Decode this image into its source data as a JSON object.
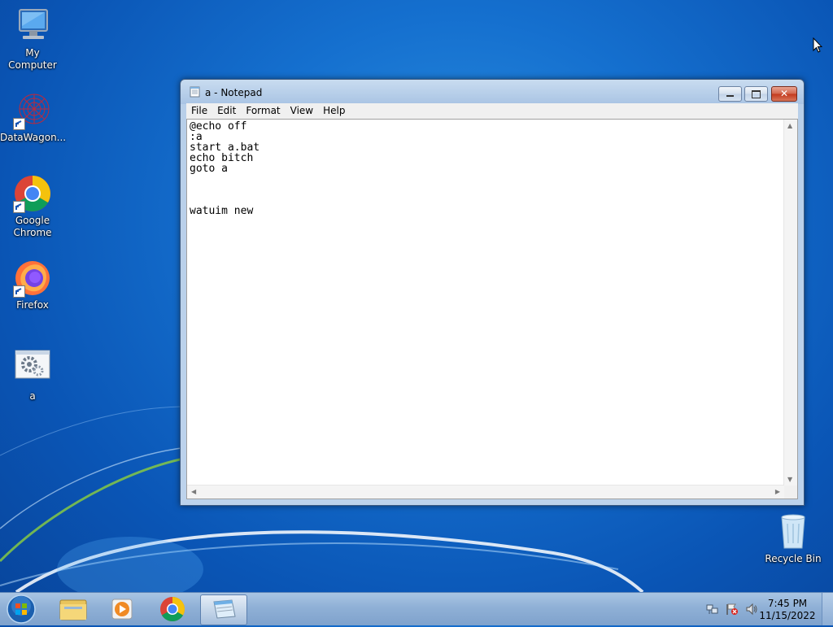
{
  "desktop": {
    "icons": [
      {
        "label": "My Computer"
      },
      {
        "label": "DataWagon..."
      },
      {
        "label": "Google Chrome"
      },
      {
        "label": "Firefox"
      },
      {
        "label": "a"
      },
      {
        "label": "Recycle Bin"
      }
    ]
  },
  "notepad": {
    "title": "a - Notepad",
    "menu": [
      "File",
      "Edit",
      "Format",
      "View",
      "Help"
    ],
    "content": "@echo off\n:a\nstart a.bat\necho bitch\ngoto a\n\n\n\nwatuim new"
  },
  "taskbar": {
    "items": [
      "start-button",
      "file-explorer",
      "media-player",
      "google-chrome",
      "notepad"
    ],
    "time": "7:45 PM",
    "date": "11/15/2022"
  },
  "colors": {
    "desktop_blue": "#1570cf",
    "taskbar": "#8fb0d6",
    "close_red": "#c3381c"
  }
}
